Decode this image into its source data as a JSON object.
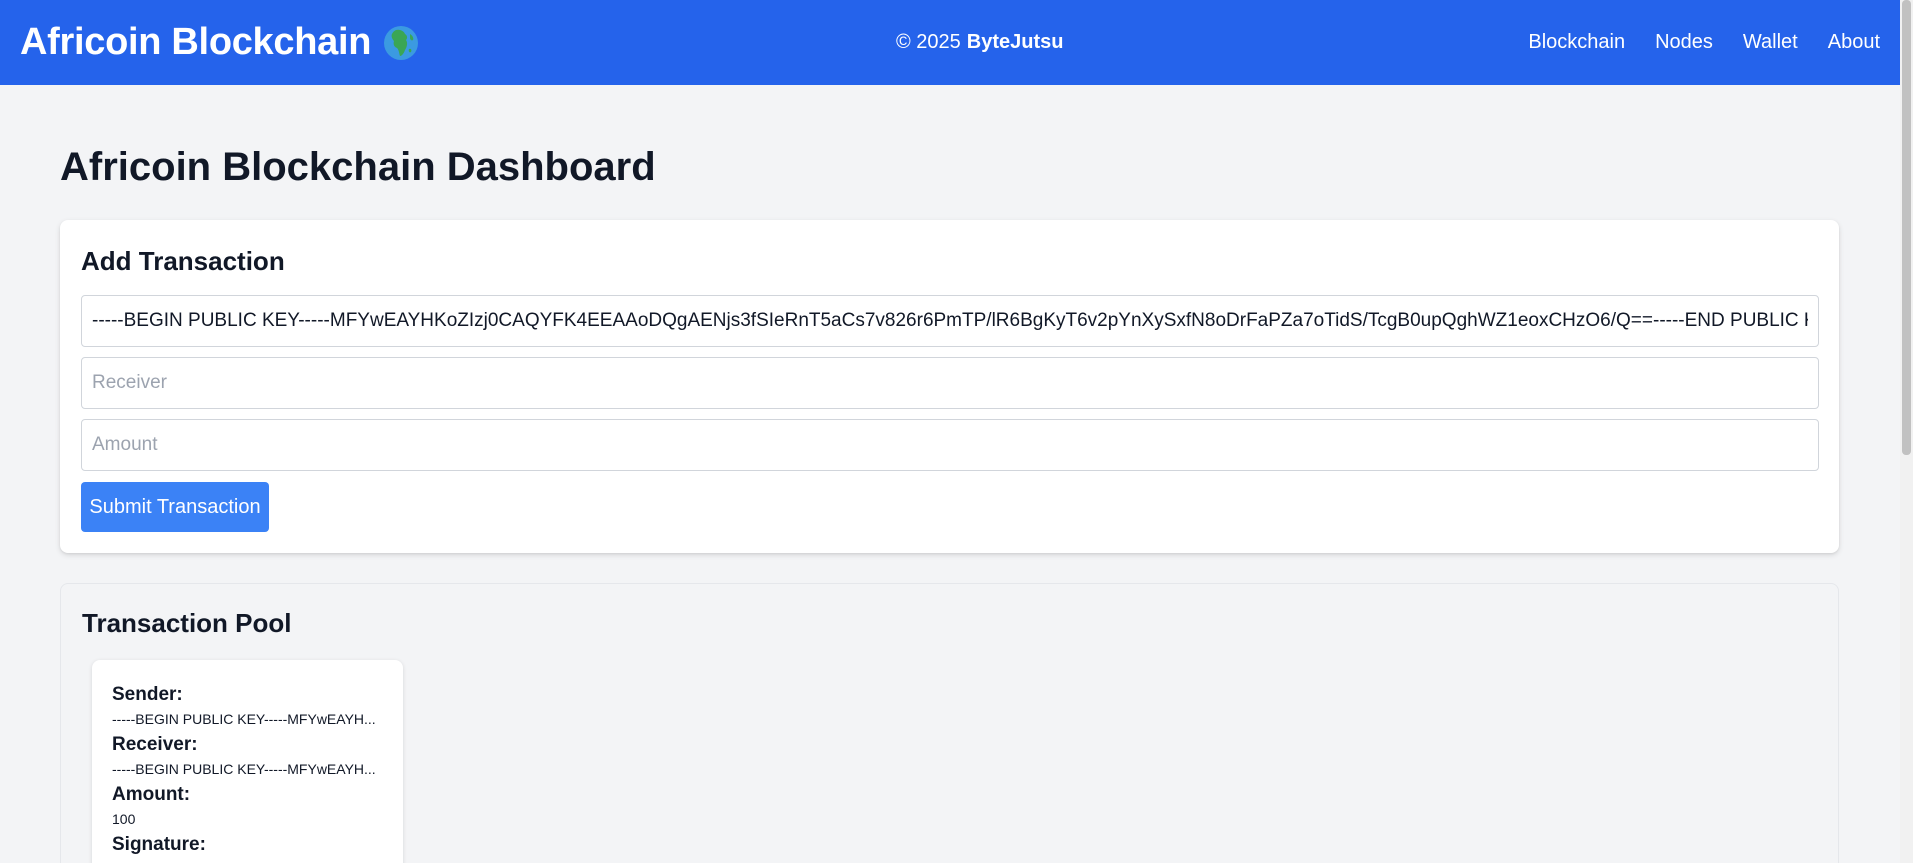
{
  "navbar": {
    "brand": "Africoin Blockchain",
    "brand_icon": "globe-africa-icon",
    "copyright_prefix": "© 2025",
    "copyright_name": "ByteJutsu",
    "links": [
      "Blockchain",
      "Nodes",
      "Wallet",
      "About"
    ],
    "color": "#2563eb"
  },
  "page": {
    "title": "Africoin Blockchain Dashboard"
  },
  "add_transaction": {
    "title": "Add Transaction",
    "sender_value": "-----BEGIN PUBLIC KEY-----MFYwEAYHKoZIzj0CAQYFK4EEAAoDQgAENjs3fSIeRnT5aCs7v826r6PmTP/lR6BgKyT6v2pYnXySxfN8oDrFaPZa7oTidS/TcgB0upQghWZ1eoxCHzO6/Q==-----END PUBLIC KEY-----",
    "receiver_placeholder": "Receiver",
    "amount_placeholder": "Amount",
    "submit_label": "Submit Transaction",
    "button_color": "#3b82f6"
  },
  "transaction_pool": {
    "title": "Transaction Pool",
    "transactions": [
      {
        "sender_label": "Sender:",
        "sender": "-----BEGIN PUBLIC KEY-----MFYwEAYH...",
        "receiver_label": "Receiver:",
        "receiver": "-----BEGIN PUBLIC KEY-----MFYwEAYH...",
        "amount_label": "Amount:",
        "amount": "100",
        "signature_label": "Signature:"
      }
    ]
  }
}
